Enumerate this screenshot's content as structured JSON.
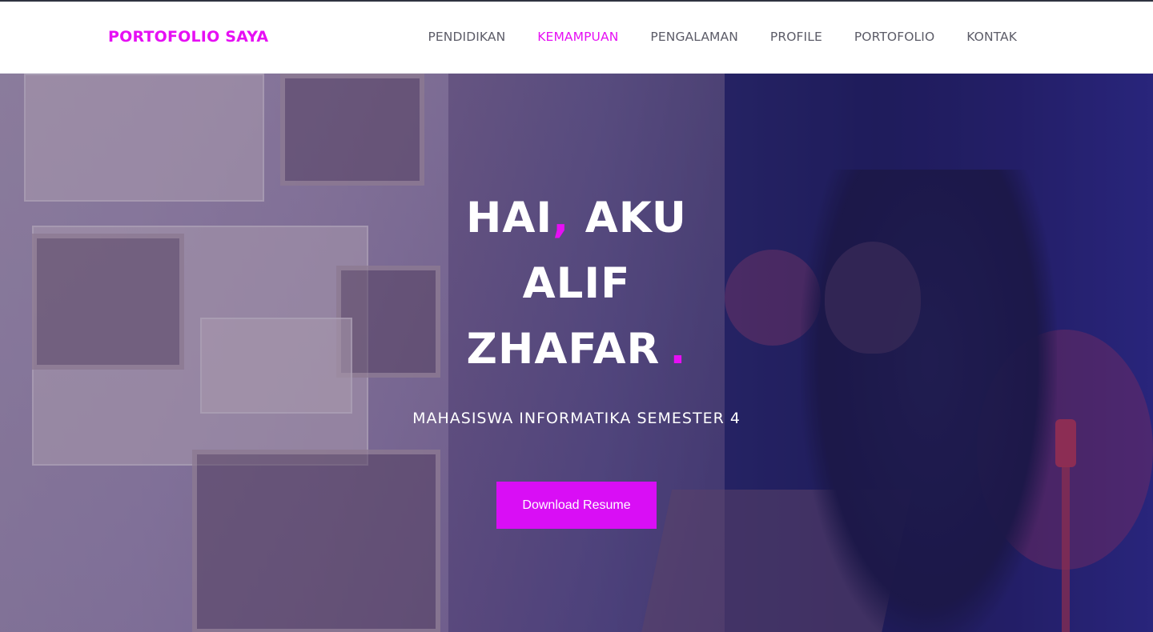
{
  "brand": "PORTOFOLIO SAYA",
  "nav": {
    "items": [
      {
        "label": "PENDIDIKAN",
        "active": false
      },
      {
        "label": "KEMAMPUAN",
        "active": true
      },
      {
        "label": "PENGALAMAN",
        "active": false
      },
      {
        "label": "PROFILE",
        "active": false
      },
      {
        "label": "PORTOFOLIO",
        "active": false
      },
      {
        "label": "KONTAK",
        "active": false
      }
    ]
  },
  "hero": {
    "line1_a": "HAI",
    "line1_comma": ",",
    "line1_b": " AKU",
    "line2": "ALIF",
    "line3": "ZHAFAR",
    "line3_dot": ".",
    "subtitle": "MAHASISWA INFORMATIKA SEMESTER 4",
    "button_label": "Download Resume"
  },
  "colors": {
    "accent": "#e60ff4",
    "button": "#d90ef5",
    "nav_text": "#5c5c68"
  }
}
